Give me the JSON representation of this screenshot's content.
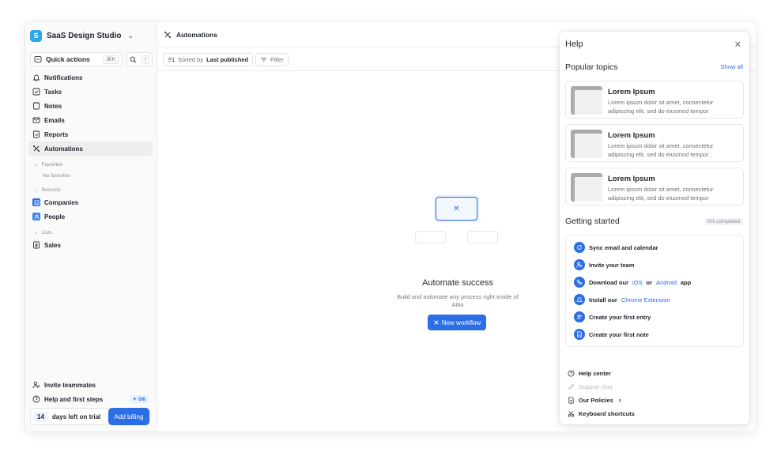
{
  "workspace": {
    "logo_letter": "S",
    "name": "SaaS Design Studio"
  },
  "quick_actions": {
    "label": "Quick actions",
    "shortcut": "⌘K",
    "search_shortcut": "/"
  },
  "nav": {
    "notifications": "Notifications",
    "tasks": "Tasks",
    "notes": "Notes",
    "emails": "Emails",
    "reports": "Reports",
    "automations": "Automations"
  },
  "favorites": {
    "label": "Favorites",
    "empty": "No favorites"
  },
  "records": {
    "label": "Records",
    "companies": "Companies",
    "people": "People"
  },
  "lists": {
    "label": "Lists",
    "sales": "Sales"
  },
  "sidebar_bottom": {
    "invite": "Invite teammates",
    "help_steps": "Help and first steps",
    "help_steps_badge": "0/6",
    "trial_days": "14",
    "trial_text": "days left on trial",
    "add_billing": "Add billing"
  },
  "main": {
    "title": "Automations",
    "sorted_prefix": "Sorted by",
    "sorted_value": "Last published",
    "filter": "Filter",
    "empty_title": "Automate success",
    "empty_desc": "Build and automate any process right inside of Attio",
    "new_workflow": "New workflow"
  },
  "help": {
    "title": "Help",
    "popular_topics": "Popular topics",
    "show_all": "Show all",
    "topics": [
      {
        "title": "Lorem Ipsum",
        "desc": "Lorem ipsum dolor sit amet, consectetur adipiscing elit, sed do eiusmod tempor"
      },
      {
        "title": "Lorem Ipsum",
        "desc": "Lorem ipsum dolor sit amet, consectetur adipiscing elit, sed do eiusmod tempor"
      },
      {
        "title": "Lorem Ipsum",
        "desc": "Lorem ipsum dolor sit amet, consectetur adipiscing elit, sed do eiusmod tempor"
      }
    ],
    "getting_started": "Getting started",
    "progress": "0% completed",
    "steps": {
      "sync": "Sync email and calendar",
      "invite": "Invite your team",
      "download_prefix": "Download our",
      "ios": "iOS",
      "or": "or",
      "android": "Android",
      "app": "app",
      "install_prefix": "Install our",
      "chrome": "Chrome Extension",
      "first_entry": "Create your first entry",
      "first_note": "Create your first note"
    },
    "links": {
      "help_center": "Help center",
      "support_chat": "Support chat",
      "policies": "Our Policies",
      "shortcuts": "Keyboard shortcuts"
    }
  },
  "colors": {
    "accent": "#2b6ee6",
    "workspace_logo": "#2ea8e6"
  }
}
